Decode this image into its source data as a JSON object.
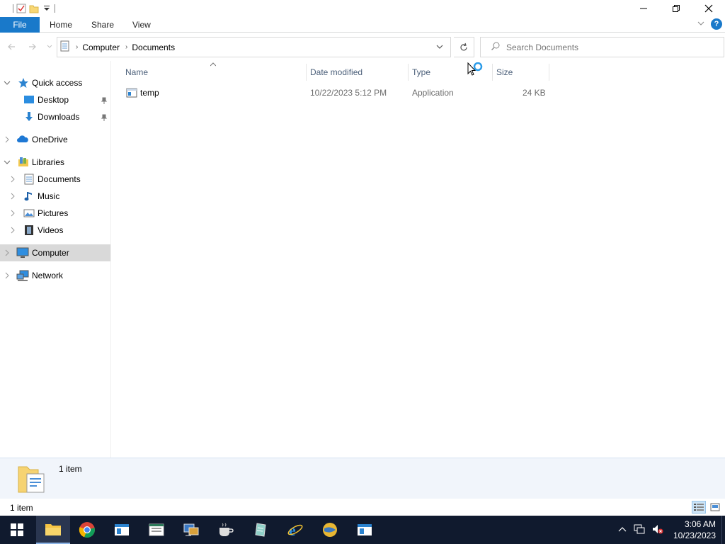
{
  "window": {
    "minimize_glyph": "—",
    "maximize_glyph": "❐",
    "close_glyph": "✕"
  },
  "ribbon": {
    "file_label": "File",
    "tabs": [
      "Home",
      "Share",
      "View"
    ]
  },
  "address": {
    "segments": [
      "Computer",
      "Documents"
    ],
    "refresh_glyph": "↻"
  },
  "search": {
    "placeholder": "Search Documents"
  },
  "nav": {
    "items": [
      {
        "label": "Quick access",
        "icon": "star-icon"
      },
      {
        "label": "Desktop",
        "icon": "desktop-icon"
      },
      {
        "label": "Downloads",
        "icon": "download-icon"
      },
      {
        "label": "OneDrive",
        "icon": "cloud-icon"
      },
      {
        "label": "Libraries",
        "icon": "libraries-icon"
      },
      {
        "label": "Documents",
        "icon": "documents-icon"
      },
      {
        "label": "Music",
        "icon": "music-icon"
      },
      {
        "label": "Pictures",
        "icon": "pictures-icon"
      },
      {
        "label": "Videos",
        "icon": "videos-icon"
      },
      {
        "label": "Computer",
        "icon": "computer-icon"
      },
      {
        "label": "Network",
        "icon": "network-icon"
      }
    ]
  },
  "columns": {
    "name": "Name",
    "date": "Date modified",
    "type": "Type",
    "size": "Size"
  },
  "files": [
    {
      "name": "temp",
      "date": "10/22/2023 5:12 PM",
      "type": "Application",
      "size": "24 KB"
    }
  ],
  "details": {
    "count": "1 item"
  },
  "status": {
    "count": "1 item"
  },
  "clock": {
    "time": "3:06 AM",
    "date": "10/23/2023"
  },
  "colors": {
    "accent": "#1979ca",
    "selected_nav": "#d9d9d9",
    "taskbar": "#101a2e"
  }
}
